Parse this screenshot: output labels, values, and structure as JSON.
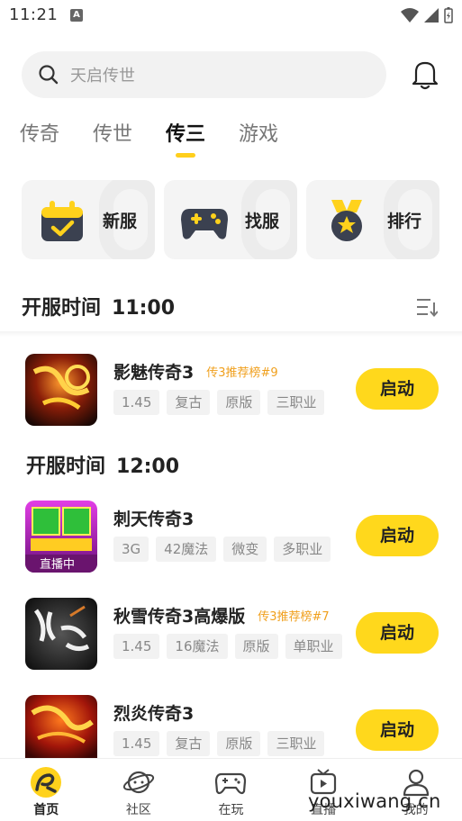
{
  "status_bar": {
    "time": "11:21",
    "notif_letter": "A"
  },
  "search": {
    "placeholder": "天启传世"
  },
  "tabs": [
    {
      "label": "传奇",
      "active": false
    },
    {
      "label": "传世",
      "active": false
    },
    {
      "label": "传三",
      "active": true
    },
    {
      "label": "游戏",
      "active": false
    }
  ],
  "quick_cards": [
    {
      "label": "新服",
      "icon": "calendar-check-icon"
    },
    {
      "label": "找服",
      "icon": "gamepad-icon"
    },
    {
      "label": "排行",
      "icon": "medal-icon"
    }
  ],
  "section1": {
    "label": "开服时间",
    "time": "11:00"
  },
  "section2": {
    "label": "开服时间",
    "time": "12:00"
  },
  "games": [
    {
      "name": "影魅传奇3",
      "rank": "传3推荐榜#9",
      "tags": [
        "1.45",
        "复古",
        "原版",
        "三职业"
      ],
      "button": "启动"
    },
    {
      "name": "刺天传奇3",
      "rank": "",
      "tags": [
        "3G",
        "42魔法",
        "微变",
        "多职业"
      ],
      "button": "启动",
      "thumb_badge": "直播中"
    },
    {
      "name": "秋雪传奇3高爆版",
      "rank": "传3推荐榜#7",
      "tags": [
        "1.45",
        "16魔法",
        "原版",
        "单职业"
      ],
      "button": "启动"
    },
    {
      "name": "烈炎传奇3",
      "rank": "",
      "tags": [
        "1.45",
        "复古",
        "原版",
        "三职业"
      ],
      "button": "启动"
    }
  ],
  "bottom_nav": [
    {
      "label": "首页",
      "active": true
    },
    {
      "label": "社区",
      "active": false
    },
    {
      "label": "在玩",
      "active": false
    },
    {
      "label": "直播",
      "active": false
    },
    {
      "label": "我的",
      "active": false
    }
  ],
  "watermark": "youxiwang.cn",
  "colors": {
    "accent": "#ffd81c",
    "rank": "#f0a01e",
    "tag_bg": "#f2f2f2"
  }
}
